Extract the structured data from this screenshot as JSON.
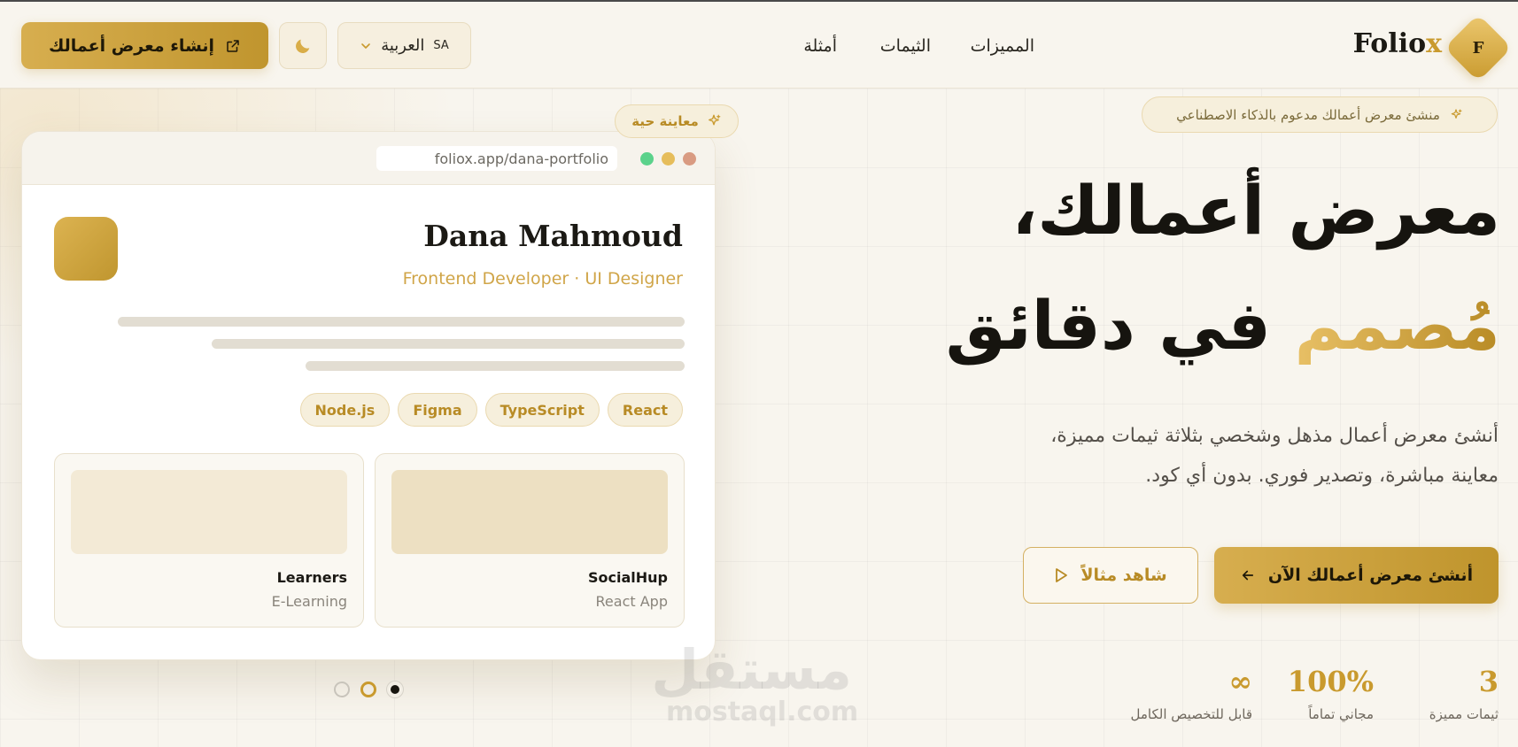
{
  "header": {
    "logo_letter": "F",
    "logo_text": "Folio",
    "logo_accent": "x",
    "nav": {
      "features": "المميزات",
      "themes": "الثيمات",
      "examples": "أمثلة"
    },
    "language": {
      "code": "SA",
      "label": "العربية"
    },
    "create_button": "إنشاء معرض أعمالك"
  },
  "hero": {
    "badge": "منشئ معرض أعمالك مدعوم بالذكاء الاصطناعي",
    "title_line1": "معرض أعمالك،",
    "title_gold": "مُصمم",
    "title_dark": "في دقائق",
    "description_line1": "أنشئ معرض أعمال مذهل وشخصي بثلاثة ثيمات مميزة،",
    "description_line2": "معاينة مباشرة، وتصدير فوري. بدون أي كود.",
    "cta_primary": "أنشئ معرض أعمالك الآن",
    "cta_secondary": "شاهد مثالاً",
    "stats": [
      {
        "value": "3",
        "label": "ثيمات مميزة"
      },
      {
        "value": "100%",
        "label": "مجاني تماماً"
      },
      {
        "value": "∞",
        "label": "قابل للتخصيص الكامل"
      }
    ]
  },
  "preview": {
    "badge": "معاينة حية",
    "url": "foliox.app/dana-portfolio",
    "name": "Dana Mahmoud",
    "role": "Frontend Developer · UI Designer",
    "tags": [
      "React",
      "TypeScript",
      "Figma",
      "Node.js"
    ],
    "projects": [
      {
        "title": "SocialHup",
        "subtitle": "React App"
      },
      {
        "title": "Learners",
        "subtitle": "E-Learning"
      }
    ],
    "carousel_active_index": 2,
    "carousel_count": 3
  },
  "watermark": {
    "arabic": "مستقل",
    "latin": "mostaql.com"
  },
  "colors": {
    "accent": "#c99a2e",
    "background": "#f8f5ee",
    "text": "#16140f"
  },
  "icons": {
    "theme_toggle": "moon-icon",
    "create": "external-link-icon",
    "badge": "sparkles-icon",
    "cta_primary": "arrow-left-icon",
    "cta_secondary": "play-icon",
    "language": "chevron-down-icon"
  }
}
